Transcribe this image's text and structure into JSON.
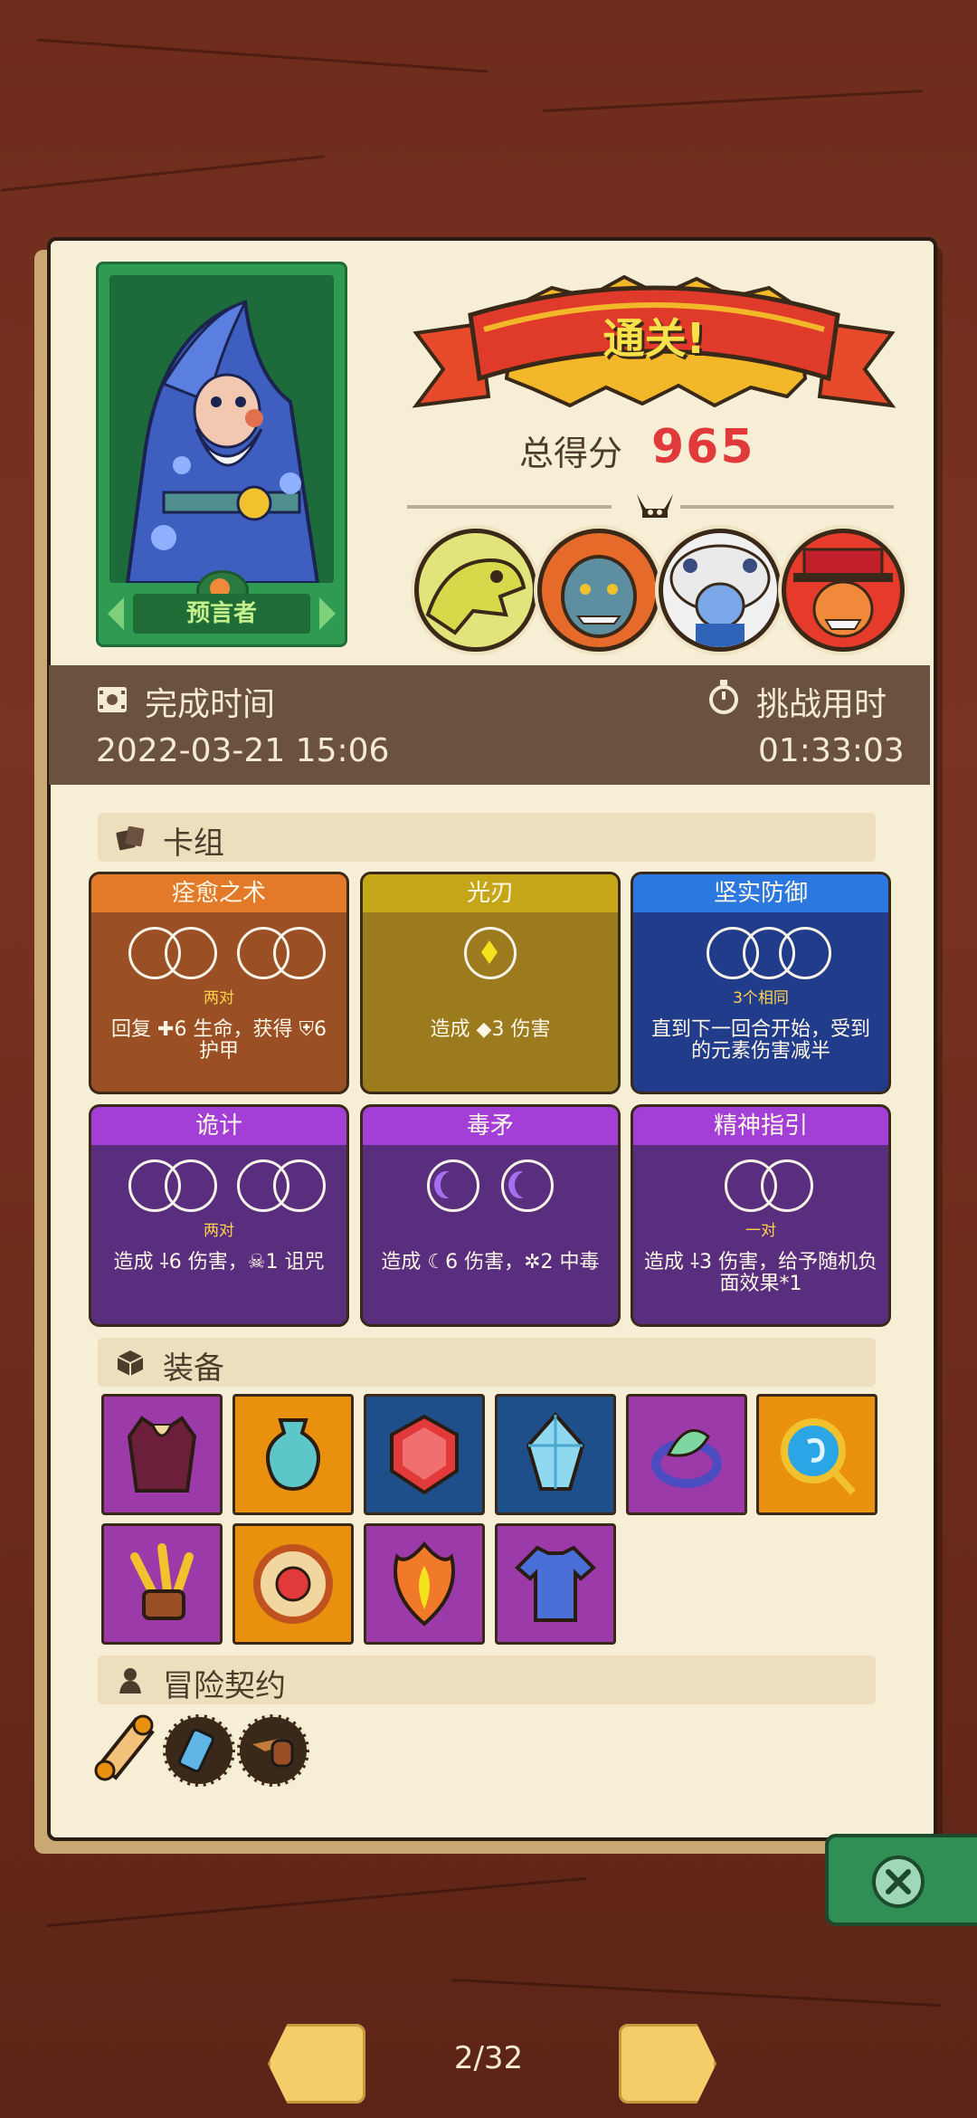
{
  "result": {
    "banner_text": "通关!",
    "score_label": "总得分",
    "score_value": "965"
  },
  "hero": {
    "name": "预言者"
  },
  "bosses": [
    "boss-dino-skeleton",
    "boss-orange-troll",
    "boss-yeti",
    "boss-red-hat-villain"
  ],
  "times": {
    "finish_label": "完成时间",
    "finish_value": "2022-03-21 15:06",
    "challenge_label": "挑战用时",
    "challenge_value": "01:33:03"
  },
  "deck": {
    "title": "卡组",
    "cards": [
      {
        "title": "痊愈之术",
        "count": "两对",
        "desc": "回复 ✚6 生命，获得 ⛨6 护甲",
        "color": "#9a4f25"
      },
      {
        "title": "光刃",
        "count": "",
        "desc": "造成 ◆3 伤害",
        "color": "#9c7a1e"
      },
      {
        "title": "坚实防御",
        "count": "3个相同",
        "desc": "直到下一回合开始，受到的元素伤害减半",
        "color": "#213c8a"
      },
      {
        "title": "诡计",
        "count": "两对",
        "desc": "造成 ⸸6 伤害，☠1 诅咒",
        "color": "#5a2e7e"
      },
      {
        "title": "毒矛",
        "count": "",
        "desc": "造成 ☾6 伤害，✲2 中毒",
        "color": "#5a2e7e"
      },
      {
        "title": "精神指引",
        "count": "一对",
        "desc": "造成 ⸸3 伤害，给予随机负面效果*1",
        "color": "#5a2e7e"
      }
    ]
  },
  "equipment": {
    "title": "装备",
    "items": [
      {
        "icon": "armor-vest-icon",
        "bg": "#9b3aa8"
      },
      {
        "icon": "vase-icon",
        "bg": "#e9900f"
      },
      {
        "icon": "red-gem-icon",
        "bg": "#1f4f8a"
      },
      {
        "icon": "blue-gem-icon",
        "bg": "#1f4f8a"
      },
      {
        "icon": "leaf-ring-icon",
        "bg": "#9b3aa8"
      },
      {
        "icon": "water-orb-icon",
        "bg": "#e9900f"
      },
      {
        "icon": "golden-claw-icon",
        "bg": "#9b3aa8"
      },
      {
        "icon": "round-shield-icon",
        "bg": "#e9900f"
      },
      {
        "icon": "fire-shield-icon",
        "bg": "#9b3aa8"
      },
      {
        "icon": "blue-tunic-icon",
        "bg": "#9b3aa8"
      }
    ]
  },
  "contract": {
    "title": "冒险契约",
    "items": [
      "scroll-icon",
      "bandage-icon",
      "pipe-icon"
    ]
  },
  "pager": {
    "text": "2/32"
  }
}
